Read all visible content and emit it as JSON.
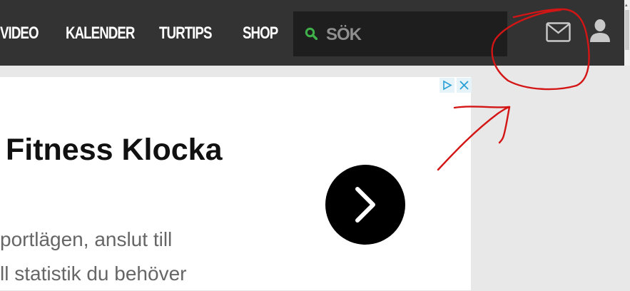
{
  "nav": {
    "links": [
      {
        "label": "VIDEO"
      },
      {
        "label": "KALENDER"
      },
      {
        "label": "TURTIPS"
      },
      {
        "label": "SHOP"
      }
    ],
    "search_placeholder": "SÖK"
  },
  "icons": {
    "search": "search-icon",
    "mail": "mail-icon",
    "user": "user-icon",
    "ad_choices": "ad-choices-icon",
    "ad_close": "close-icon",
    "cta": "chevron-right-icon"
  },
  "ad": {
    "title": "Fitness Klocka",
    "body_lines": [
      "portlägen, anslut till",
      "ll statistik du behöver"
    ]
  },
  "colors": {
    "topbar": "#333333",
    "search_bg": "#1e1e1e",
    "search_icon": "#3fb04a",
    "annotation": "#d41515",
    "ad_badge": "#2a9fd6"
  }
}
